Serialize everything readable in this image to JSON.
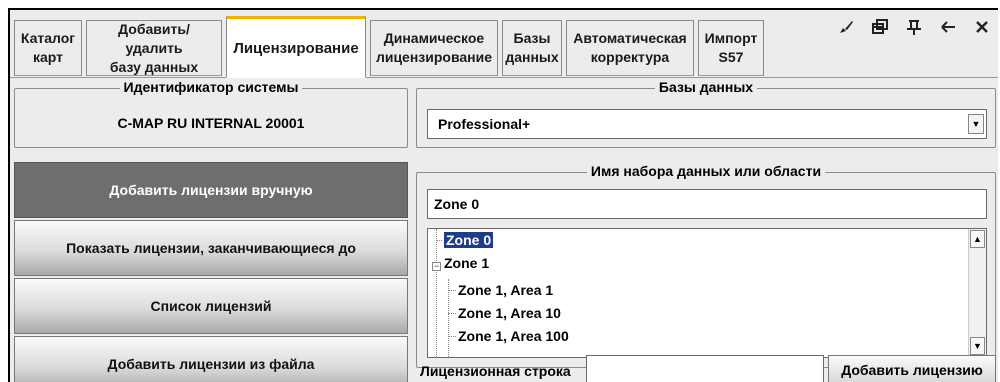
{
  "tabs": [
    {
      "label": "Каталог\nкарт"
    },
    {
      "label": "Добавить/удалить\nбазу данных"
    },
    {
      "label": "Лицензирование"
    },
    {
      "label": "Динамическое\nлицензирование"
    },
    {
      "label": "Базы\nданных"
    },
    {
      "label": "Автоматическая\nкорректура"
    },
    {
      "label": "Импорт\nS57"
    }
  ],
  "active_tab": "Лицензирование",
  "window_controls": [
    {
      "icon": "brush-icon",
      "glyph": "✔"
    },
    {
      "icon": "restore-icon",
      "glyph": "🗗"
    },
    {
      "icon": "pin-icon",
      "glyph": "Ⅱ"
    },
    {
      "icon": "back-icon",
      "glyph": "←"
    },
    {
      "icon": "close-icon",
      "glyph": "✕"
    }
  ],
  "left": {
    "system_id_label": "Идентификатор системы",
    "system_id_value": "C-MAP RU INTERNAL 20001",
    "buttons": [
      {
        "label": "Добавить лицензии вручную",
        "active": true
      },
      {
        "label": "Показать лицензии, заканчивающиеся до",
        "active": false
      },
      {
        "label": "Список лицензий",
        "active": false
      },
      {
        "label": "Добавить лицензии из файла",
        "active": false
      }
    ]
  },
  "right": {
    "databases_label": "Базы данных",
    "database_selected": "Professional+",
    "dataset_label": "Имя набора данных или области",
    "dataset_value": "Zone 0",
    "tree": [
      {
        "label": "Zone 0",
        "level": 0,
        "selected": true
      },
      {
        "label": "Zone 1",
        "level": 0,
        "expanded": true
      },
      {
        "label": "Zone 1, Area 1",
        "level": 1
      },
      {
        "label": "Zone 1, Area 10",
        "level": 1
      },
      {
        "label": "Zone 1, Area 100",
        "level": 1
      }
    ],
    "license_string_label": "Лицензионная строка",
    "license_string_value": "",
    "add_license_button": "Добавить лицензию"
  },
  "colors": {
    "active_tab_accent": "#f0b000",
    "selected_button_bg": "#6e6e6e",
    "tree_selection": "#1f3b8a"
  }
}
